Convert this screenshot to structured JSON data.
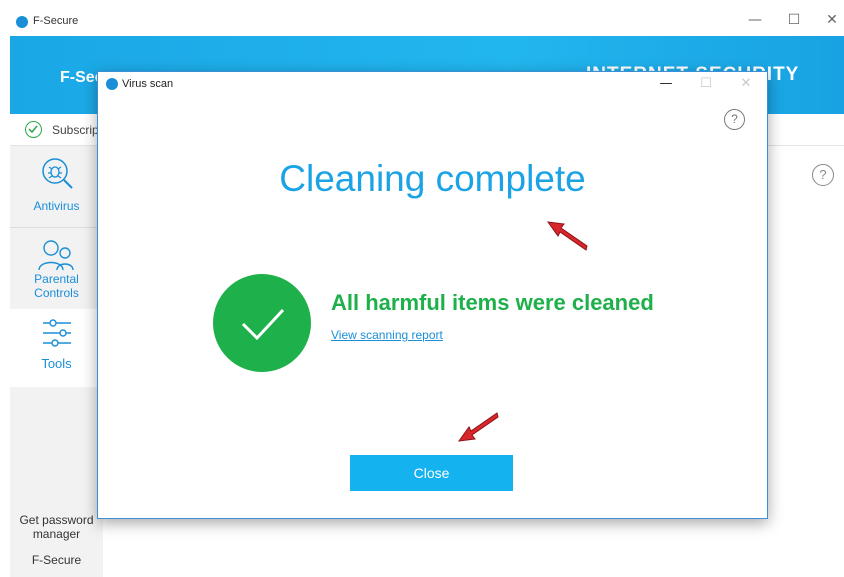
{
  "main_window": {
    "title": "F-Secure",
    "controls": {
      "minimize": "—",
      "maximize": "☐",
      "close": "✕"
    },
    "banner": {
      "brand": "F-Sec",
      "product": "INTERNET SECURITY"
    },
    "subscription": {
      "text": "Subscrip"
    },
    "help": "?",
    "sidebar": {
      "items": [
        {
          "label": "Antivirus",
          "icon": "antivirus-bug-icon"
        },
        {
          "label": "Parental Controls",
          "label_lines": [
            "Parental",
            "Controls"
          ],
          "icon": "parental-controls-icon"
        },
        {
          "label": "Tools",
          "icon": "tools-sliders-icon",
          "selected": true
        }
      ],
      "get_password_manager": [
        "Get password",
        "manager"
      ],
      "footer": "F-Secure"
    }
  },
  "dialog": {
    "title": "Virus scan",
    "controls": {
      "minimize": "—",
      "maximize": "☐",
      "close": "✕"
    },
    "help": "?",
    "heading": "Cleaning complete",
    "status_message": "All harmful items were cleaned",
    "report_link": "View scanning report",
    "close_button": "Close"
  },
  "colors": {
    "accent_blue": "#1ba3e5",
    "success_green": "#1eb04a",
    "button_blue": "#14b2ee",
    "annotation_arrow": "#d9262b"
  }
}
